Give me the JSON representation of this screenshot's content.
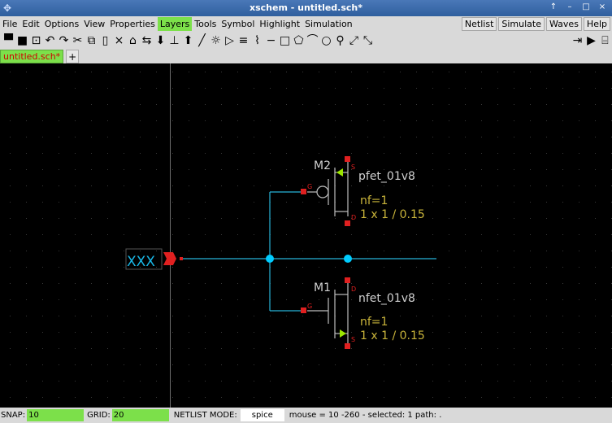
{
  "window": {
    "title": "xschem - untitled.sch*",
    "app_icon": "xschem-app-icon",
    "controls": [
      "↑",
      "–",
      "□",
      "×"
    ]
  },
  "menu": {
    "left": [
      "File",
      "Edit",
      "Options",
      "View",
      "Properties",
      "Layers",
      "Tools",
      "Symbol",
      "Highlight",
      "Simulation"
    ],
    "active": "Layers",
    "right": [
      "Netlist",
      "Simulate",
      "Waves",
      "Help"
    ]
  },
  "toolbar": {
    "left_icons": [
      "open-icon",
      "save-icon",
      "reload-icon",
      "undo-icon",
      "redo-icon",
      "cut-icon",
      "copy-icon",
      "paste-icon",
      "delete-icon",
      "move-icon",
      "duplicate-icon",
      "descend-icon",
      "insert-icon",
      "ascend-icon",
      "wire-icon",
      "highlight-icon",
      "symbol-icon",
      "text-icon",
      "pin-icon",
      "line-icon",
      "rect-icon",
      "polygon-icon",
      "arc-icon",
      "circle-icon",
      "zoom-icon",
      "zoom-in-icon",
      "zoom-out-icon"
    ],
    "right_icons": [
      "netlist-icon",
      "simulate-icon",
      "waves-icon"
    ]
  },
  "tabs": {
    "active_label": "untitled.sch*",
    "add_label": "+"
  },
  "schematic": {
    "input_pin_label": "XXX",
    "pmos": {
      "name": "M2",
      "model": "pfet_01v8",
      "param1": "nf=1",
      "param2": "1 x 1 / 0.15",
      "pins": {
        "gate": "G",
        "source": "S",
        "drain": "D"
      }
    },
    "nmos": {
      "name": "M1",
      "model": "nfet_01v8",
      "param1": "nf=1",
      "param2": "1 x 1 / 0.15",
      "pins": {
        "gate": "G",
        "source": "S",
        "drain": "D"
      }
    },
    "colors": {
      "wire": "#27b3d8",
      "pin": "#e02020",
      "device": "#bdbdbd",
      "param": "#c9b43a",
      "arrow": "#9be600",
      "dot": "#00ccff"
    }
  },
  "status": {
    "snap_label": "SNAP:",
    "snap_value": "10",
    "grid_label": "GRID:",
    "grid_value": "20",
    "mode_label": "NETLIST MODE:",
    "mode_value": "spice",
    "info": "mouse = 10 -260 - selected: 1 path: ."
  }
}
